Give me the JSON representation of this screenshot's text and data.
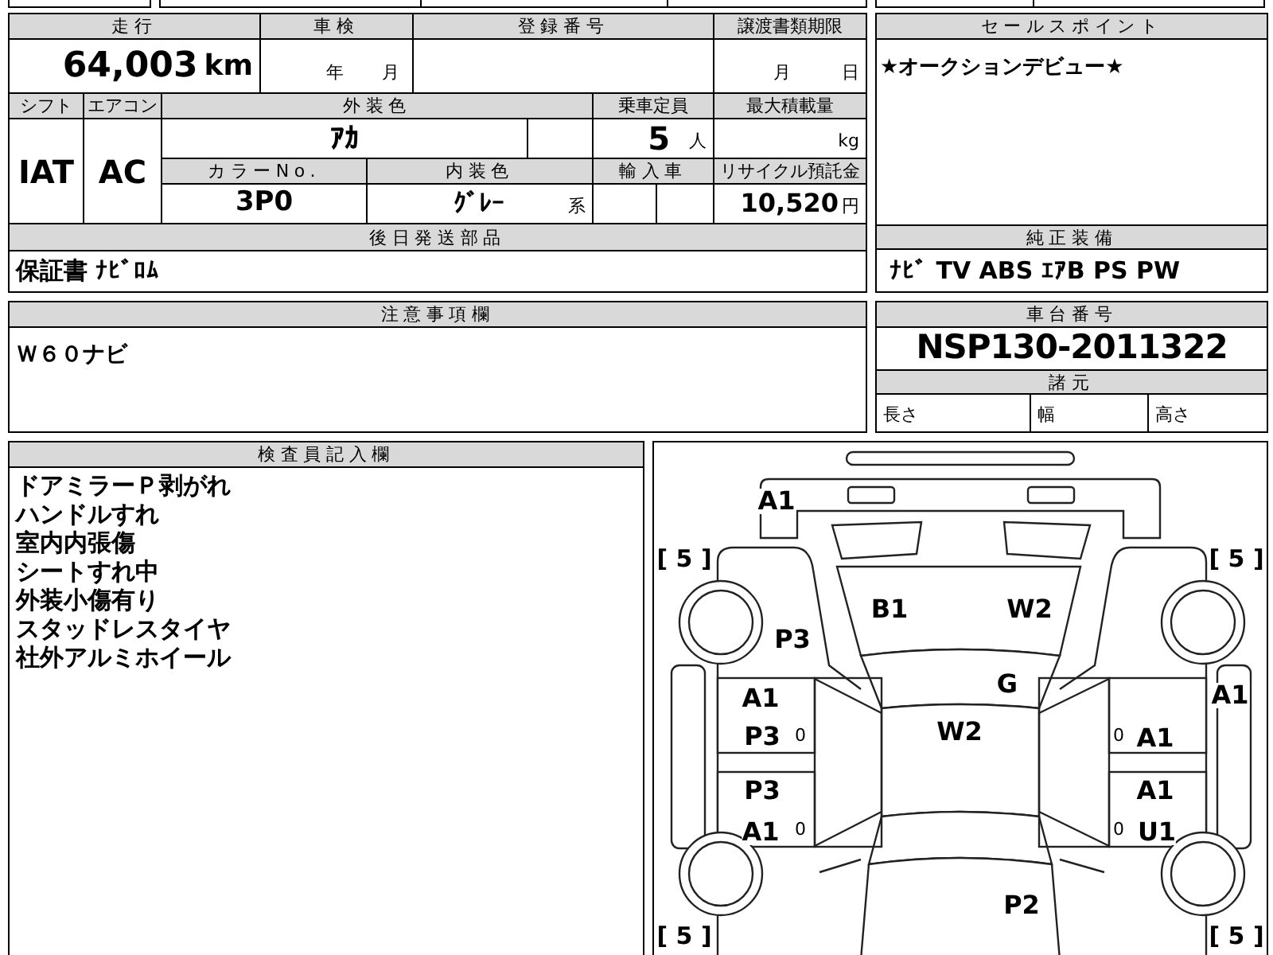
{
  "vehicle_info": {
    "mileage_label": "走行",
    "mileage": "64,003",
    "mileage_unit": "km",
    "inspection_label": "車検",
    "inspection_year_unit": "年",
    "inspection_month_unit": "月",
    "registration_label": "登録番号",
    "transfer_deadline_label": "譲渡書類期限",
    "transfer_month_unit": "月",
    "transfer_day_unit": "日",
    "shift_label": "シフト",
    "shift": "IAT",
    "ac_label": "エアコン",
    "ac": "AC",
    "exterior_color_label": "外装色",
    "exterior_color": "ｱｶ",
    "capacity_label": "乗車定員",
    "capacity": "5",
    "capacity_unit": "人",
    "max_load_label": "最大積載量",
    "max_load_unit": "kg",
    "color_no_label": "カラーNo.",
    "color_no": "3P0",
    "interior_color_label": "内装色",
    "interior_color": "ｸﾞﾚｰ",
    "interior_color_suffix": "系",
    "import_label": "輸入車",
    "recycle_label": "リサイクル預託金",
    "recycle_fee": "10,520",
    "recycle_unit": "円",
    "later_parts_label": "後日発送部品",
    "later_parts": "保証書 ﾅﾋﾞﾛﾑ"
  },
  "sales_point": {
    "label": "セールスポイント",
    "text": "★オークションデビュー★"
  },
  "equipment": {
    "label": "純正装備",
    "text": "ﾅﾋﾞ TV ABS ｴｱB PS PW"
  },
  "notes": {
    "label": "注意事項欄",
    "text": "Ｗ６０ナビ"
  },
  "chassis": {
    "label": "車台番号",
    "number": "NSP130-2011322",
    "specs_label": "諸元",
    "length_label": "長さ",
    "width_label": "幅",
    "height_label": "高さ"
  },
  "inspector": {
    "label": "検査員記入欄",
    "lines": [
      "ドアミラーＰ剥がれ",
      "ハンドルすれ",
      "室内内張傷",
      "シートすれ中",
      "外装小傷有り",
      "スタッドレスタイヤ",
      "社外アルミホイール"
    ]
  },
  "diagram": {
    "tire_ratings": [
      "[ 5 ]",
      "[ 5 ]",
      "[ 5 ]",
      "[ 5 ]"
    ],
    "damage_marks": [
      "A1",
      "B1",
      "W2",
      "P3",
      "G",
      "A1",
      "A1",
      "P3",
      "0",
      "W2",
      "0",
      "A1",
      "P3",
      "A1",
      "A1",
      "0",
      "0",
      "U1",
      "P2"
    ]
  }
}
